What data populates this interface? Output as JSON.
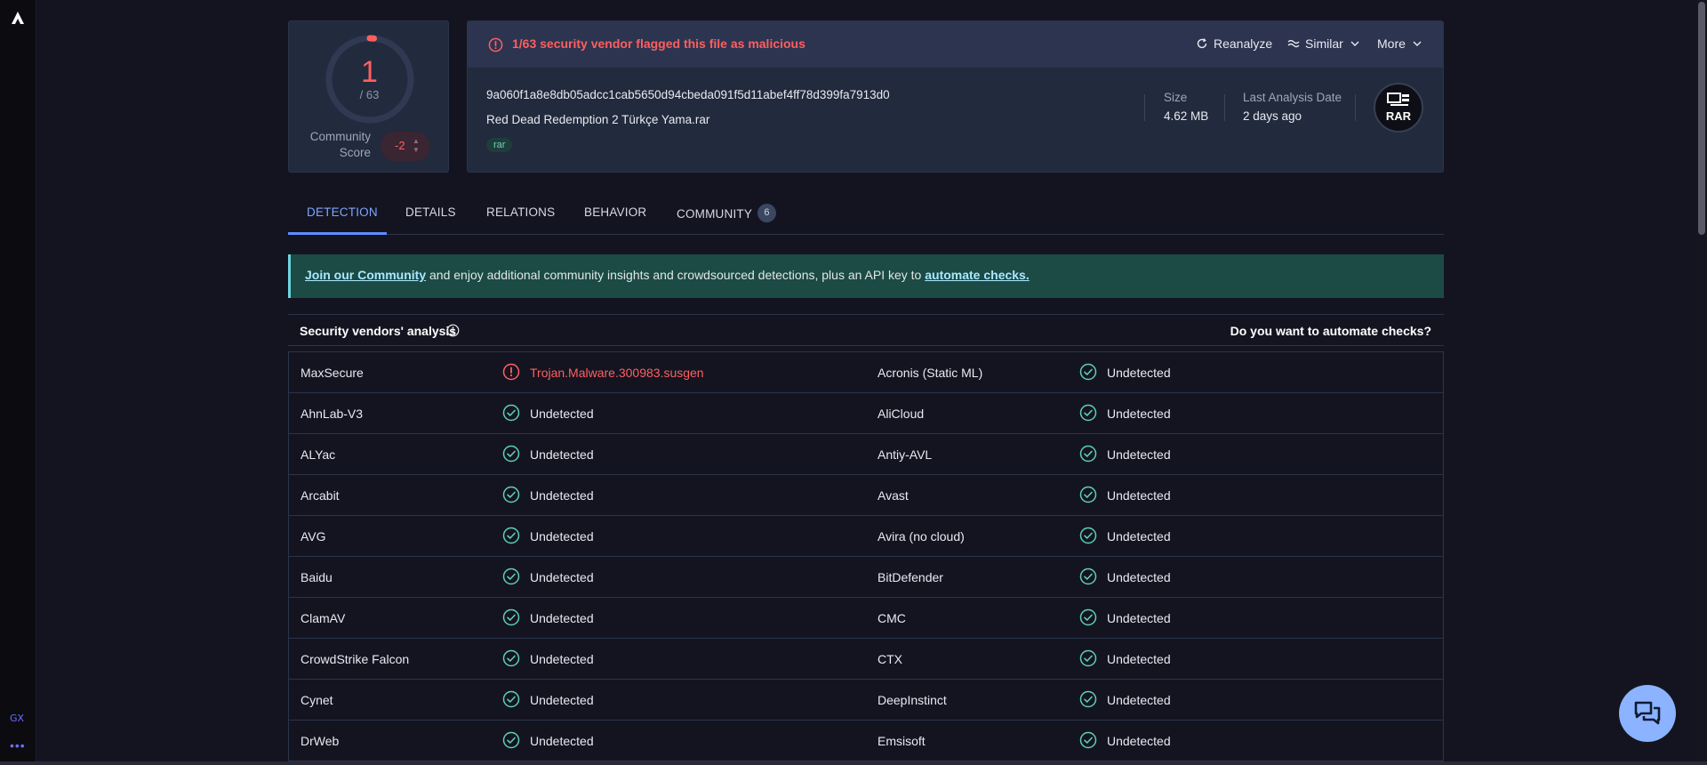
{
  "browser": {
    "gx_label": "GX",
    "more_dots": "•••"
  },
  "score": {
    "detections": "1",
    "total": "/ 63",
    "community_label_line1": "Community",
    "community_label_line2": "Score",
    "community_value": "-2",
    "detection_fraction": 0.016
  },
  "file": {
    "alert": "1/63 security vendor flagged this file as malicious",
    "actions": {
      "reanalyze": "Reanalyze",
      "similar": "Similar",
      "more": "More"
    },
    "hash": "9a060f1a8e8db05adcc1cab5650d94cbeda091f5d11abef4ff78d399fa7913d0",
    "name": "Red Dead Redemption 2 Türkçe Yama.rar",
    "tag": "rar",
    "size_label": "Size",
    "size_value": "4.62 MB",
    "date_label": "Last Analysis Date",
    "date_value": "2 days ago",
    "type_badge": "RAR"
  },
  "tabs": [
    {
      "label": "DETECTION"
    },
    {
      "label": "DETAILS"
    },
    {
      "label": "RELATIONS"
    },
    {
      "label": "BEHAVIOR"
    },
    {
      "label": "COMMUNITY",
      "badge": "6"
    }
  ],
  "banner": {
    "link1": "Join our Community",
    "middle": " and enjoy additional community insights and crowdsourced detections, plus an API key to ",
    "link2": "automate checks."
  },
  "vendors": {
    "title": "Security vendors' analysis",
    "automate": "Do you want to automate checks?",
    "rows": [
      {
        "left_name": "MaxSecure",
        "left_result": "Trojan.Malware.300983.susgen",
        "left_malicious": true,
        "right_name": "Acronis (Static ML)",
        "right_result": "Undetected"
      },
      {
        "left_name": "AhnLab-V3",
        "left_result": "Undetected",
        "left_malicious": false,
        "right_name": "AliCloud",
        "right_result": "Undetected"
      },
      {
        "left_name": "ALYac",
        "left_result": "Undetected",
        "left_malicious": false,
        "right_name": "Antiy-AVL",
        "right_result": "Undetected"
      },
      {
        "left_name": "Arcabit",
        "left_result": "Undetected",
        "left_malicious": false,
        "right_name": "Avast",
        "right_result": "Undetected"
      },
      {
        "left_name": "AVG",
        "left_result": "Undetected",
        "left_malicious": false,
        "right_name": "Avira (no cloud)",
        "right_result": "Undetected"
      },
      {
        "left_name": "Baidu",
        "left_result": "Undetected",
        "left_malicious": false,
        "right_name": "BitDefender",
        "right_result": "Undetected"
      },
      {
        "left_name": "ClamAV",
        "left_result": "Undetected",
        "left_malicious": false,
        "right_name": "CMC",
        "right_result": "Undetected"
      },
      {
        "left_name": "CrowdStrike Falcon",
        "left_result": "Undetected",
        "left_malicious": false,
        "right_name": "CTX",
        "right_result": "Undetected"
      },
      {
        "left_name": "Cynet",
        "left_result": "Undetected",
        "left_malicious": false,
        "right_name": "DeepInstinct",
        "right_result": "Undetected"
      },
      {
        "left_name": "DrWeb",
        "left_result": "Undetected",
        "left_malicious": false,
        "right_name": "Emsisoft",
        "right_result": "Undetected"
      }
    ]
  },
  "colors": {
    "malicious": "#ff5f5f",
    "clean": "#5fcfb0",
    "accent": "#5e8cff"
  }
}
